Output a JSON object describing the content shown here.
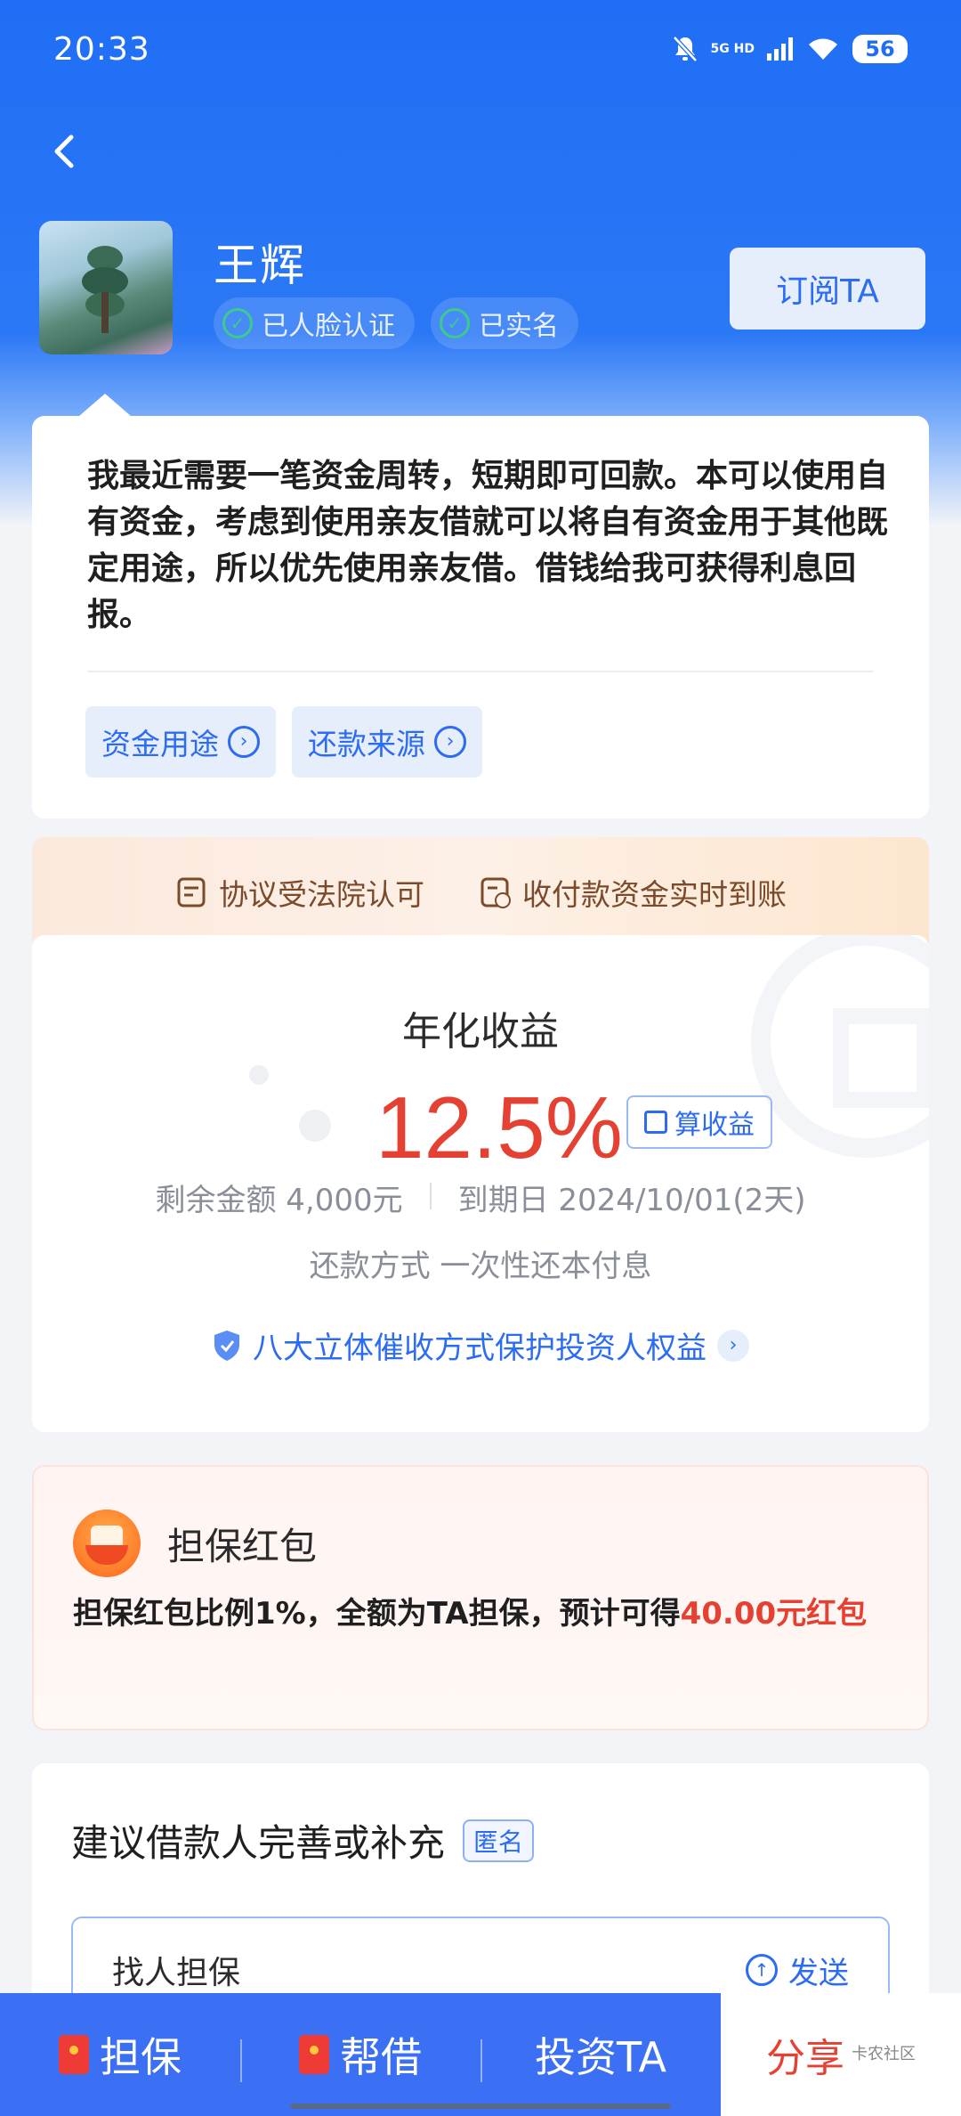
{
  "status": {
    "time": "20:33",
    "network": "5G HD",
    "battery": "56"
  },
  "profile": {
    "name": "王辉",
    "badges": [
      "已人脸认证",
      "已实名"
    ],
    "subscribe": "订阅TA"
  },
  "description": {
    "text": "我最近需要一笔资金周转，短期即可回款。本可以使用自有资金，考虑到使用亲友借就可以将自有资金用于其他既定用途，所以优先使用亲友借。借钱给我可获得利息回报。",
    "tags": [
      "资金用途",
      "还款来源"
    ]
  },
  "assurance": {
    "items": [
      "协议受法院认可",
      "收付款资金实时到账"
    ]
  },
  "yield": {
    "title": "年化收益",
    "rate": "12.5%",
    "calc_label": "算收益",
    "remaining": "剩余金额 4,000元",
    "due": "到期日 2024/10/01(2天)",
    "method": "还款方式 一次性还本付息",
    "protect": "八大立体催收方式保护投资人权益"
  },
  "hongbao": {
    "title": "担保红包",
    "text_prefix": "担保红包比例1%，全额为TA担保，预计可得",
    "text_amount": "40.00元红包"
  },
  "suggest": {
    "title": "建议借款人完善或补充",
    "tag": "匿名",
    "input_value": "找人担保",
    "send": "发送"
  },
  "bottom": {
    "actions": [
      "担保",
      "帮借",
      "投资TA"
    ],
    "share": "分享",
    "watermark": "卡农社区"
  },
  "colors": {
    "primary": "#1f6ef5",
    "accent_red": "#e54133",
    "button_blue": "#3b6ff4"
  }
}
